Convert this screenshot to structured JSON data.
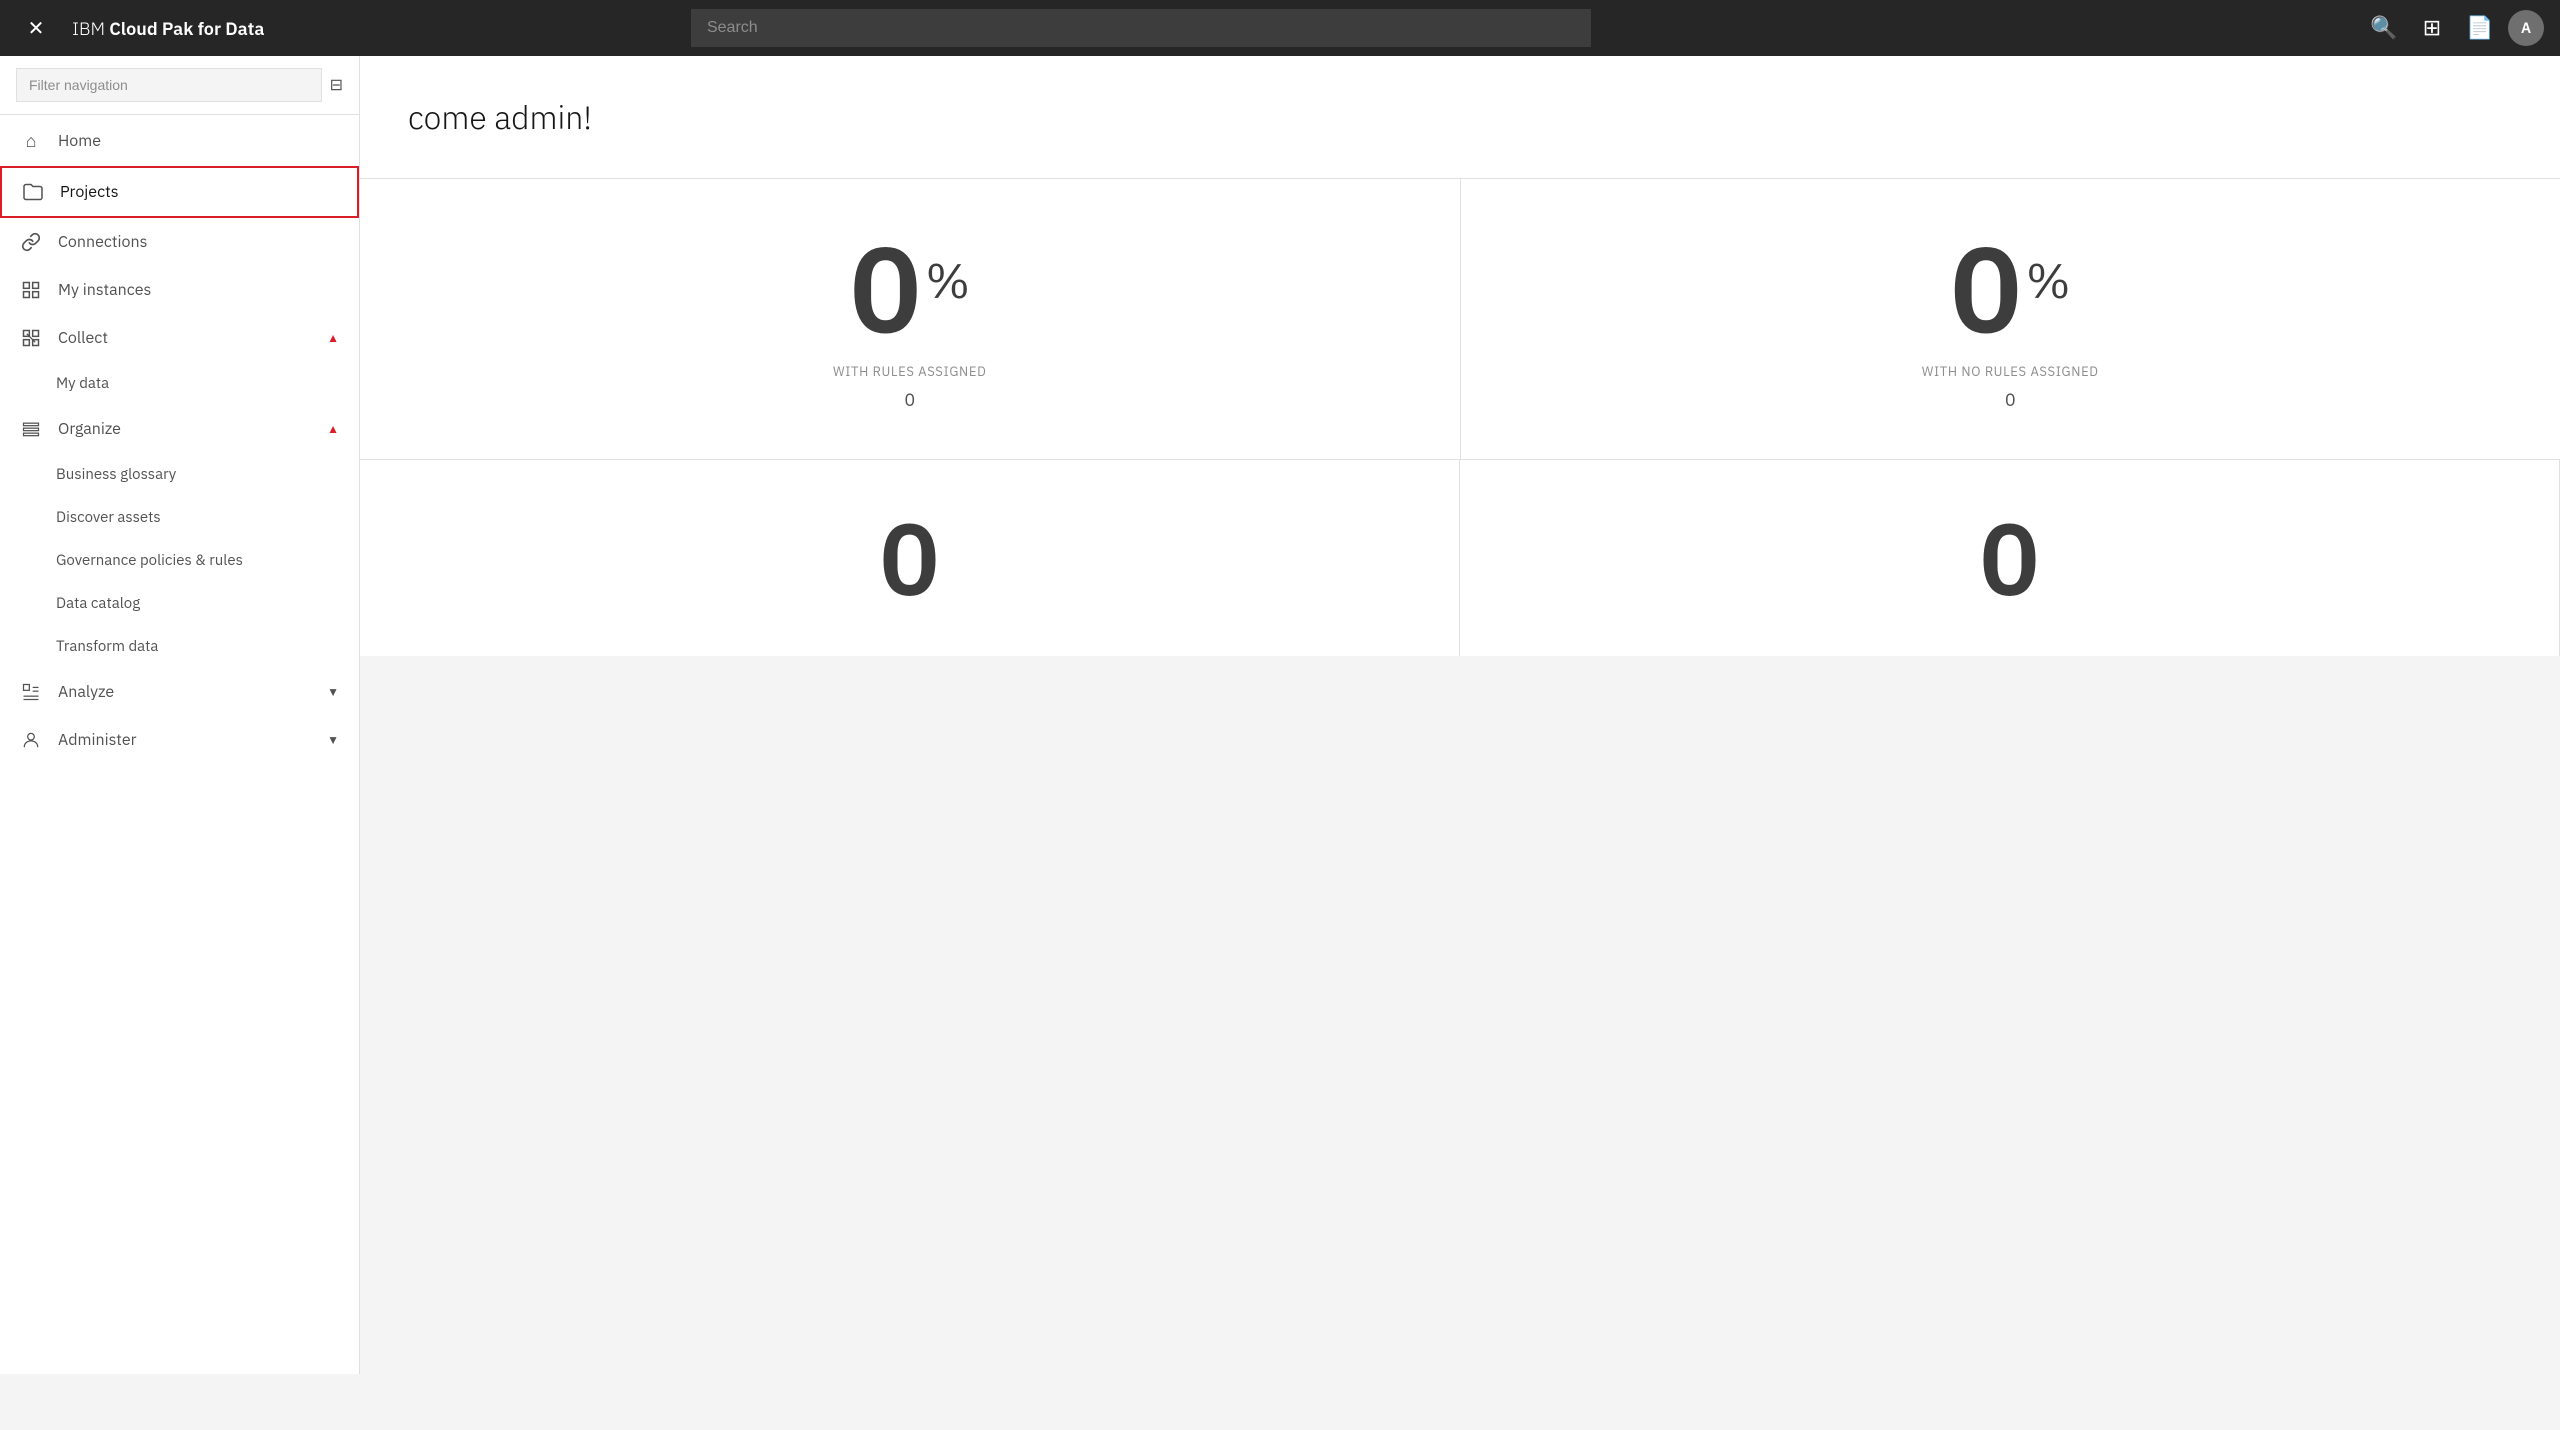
{
  "app": {
    "title": "IBM ",
    "title_bold": "Cloud Pak for Data"
  },
  "topnav": {
    "search_placeholder": "Search",
    "avatar_label": "A",
    "close_icon": "✕",
    "search_icon": "⌕",
    "apps_icon": "⊞",
    "doc_icon": "📄"
  },
  "sidebar": {
    "filter_placeholder": "Filter navigation",
    "collapse_icon": "⊟",
    "nav_items": [
      {
        "id": "home",
        "label": "Home",
        "icon": "home",
        "active": false,
        "has_children": false
      },
      {
        "id": "projects",
        "label": "Projects",
        "icon": "folder",
        "active": true,
        "has_children": false
      },
      {
        "id": "connections",
        "label": "Connections",
        "icon": "link",
        "active": false,
        "has_children": false
      },
      {
        "id": "my-instances",
        "label": "My instances",
        "icon": "grid",
        "active": false,
        "has_children": false
      },
      {
        "id": "collect",
        "label": "Collect",
        "icon": "collect",
        "active": false,
        "has_children": true,
        "expanded": true,
        "chevron": "▲"
      },
      {
        "id": "organize",
        "label": "Organize",
        "icon": "organize",
        "active": false,
        "has_children": true,
        "expanded": true,
        "chevron": "▲"
      },
      {
        "id": "analyze",
        "label": "Analyze",
        "icon": "analyze",
        "active": false,
        "has_children": true,
        "expanded": false,
        "chevron": "▼"
      },
      {
        "id": "administer",
        "label": "Administer",
        "icon": "administer",
        "active": false,
        "has_children": true,
        "expanded": false,
        "chevron": "▼"
      }
    ],
    "collect_children": [
      {
        "id": "my-data",
        "label": "My data"
      }
    ],
    "organize_children": [
      {
        "id": "business-glossary",
        "label": "Business glossary"
      },
      {
        "id": "discover-assets",
        "label": "Discover assets"
      },
      {
        "id": "governance-policies",
        "label": "Governance policies & rules"
      },
      {
        "id": "data-catalog",
        "label": "Data catalog"
      },
      {
        "id": "transform-data",
        "label": "Transform data"
      }
    ]
  },
  "main": {
    "welcome_text": "come admin!",
    "stats_row1": [
      {
        "id": "with-rules",
        "value": "0",
        "suffix": "%",
        "label": "WITH RULES ASSIGNED",
        "count": "0"
      },
      {
        "id": "no-rules",
        "value": "0",
        "suffix": "%",
        "label": "WITH NO RULES ASSIGNED",
        "count": "0"
      }
    ],
    "stats_row2": [
      {
        "id": "stat3",
        "value": "0",
        "suffix": "%",
        "label": "",
        "count": ""
      },
      {
        "id": "stat4",
        "value": "0",
        "suffix": "%",
        "label": "",
        "count": ""
      }
    ]
  }
}
